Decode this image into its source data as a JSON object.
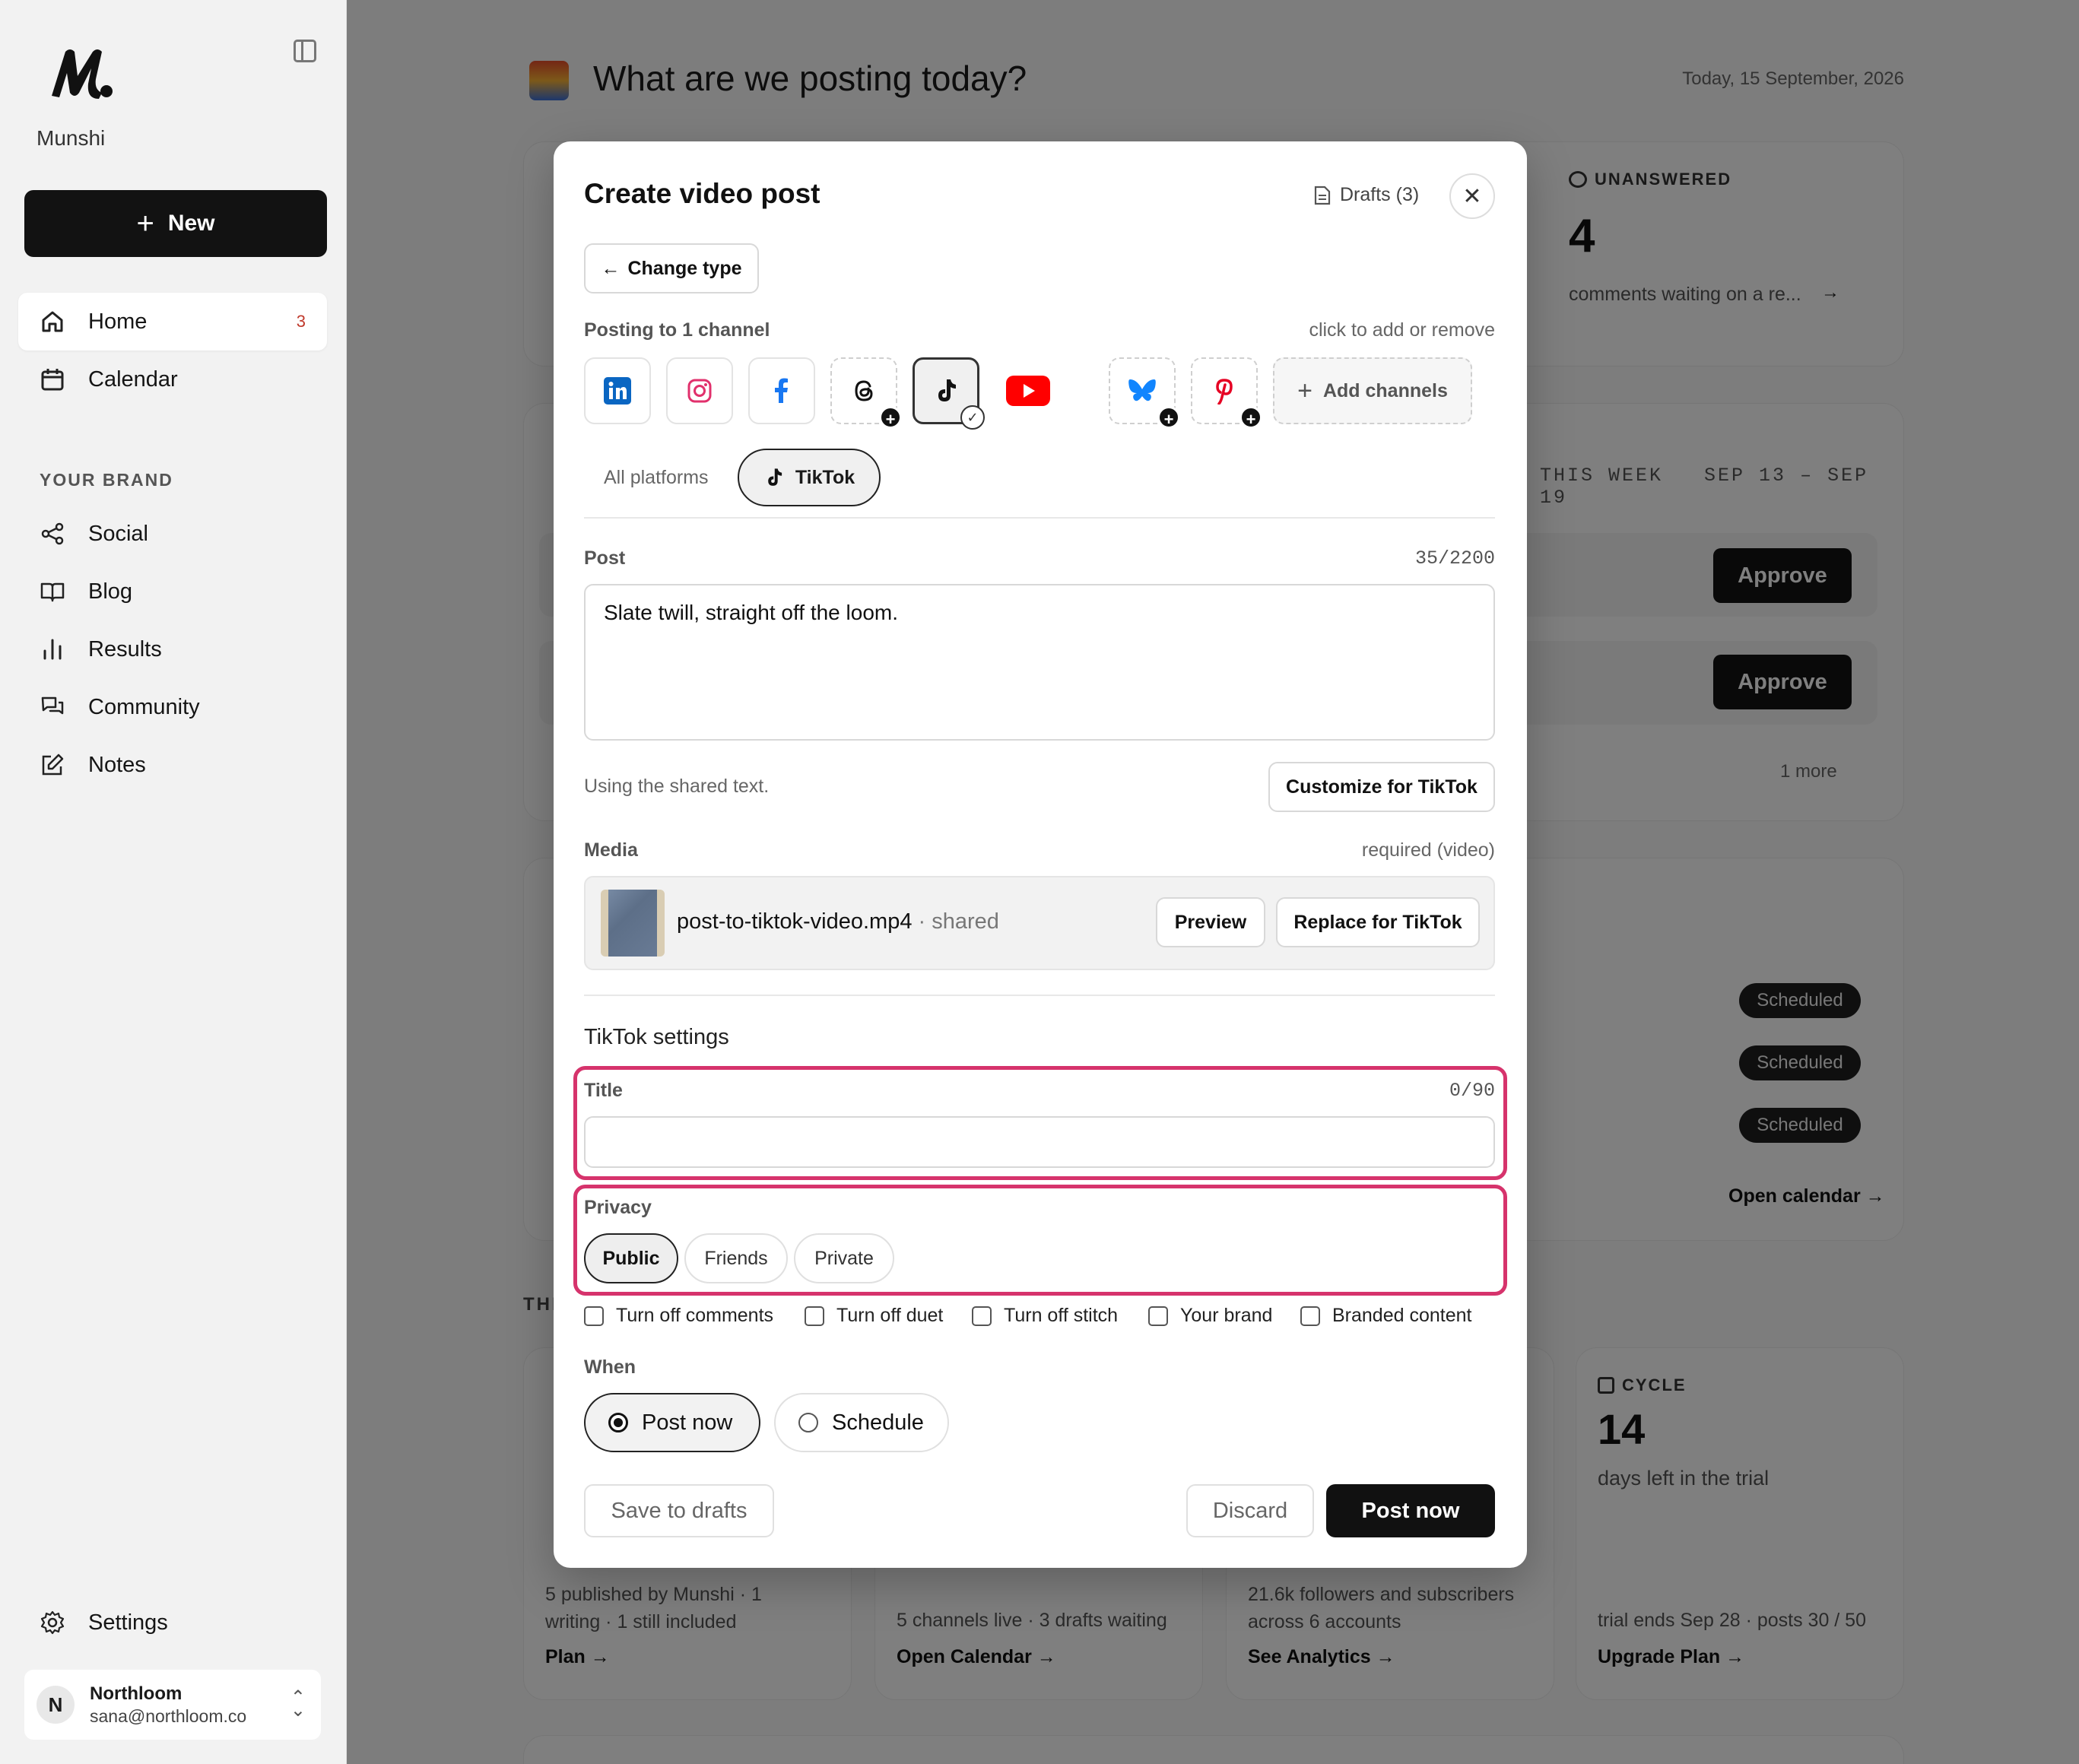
{
  "sidebar": {
    "brand": "Munshi",
    "new_label": "New",
    "nav": [
      {
        "label": "Home",
        "badge": "3"
      },
      {
        "label": "Calendar"
      }
    ],
    "section_label": "YOUR BRAND",
    "brand_nav": [
      {
        "label": "Social"
      },
      {
        "label": "Blog"
      },
      {
        "label": "Results"
      },
      {
        "label": "Community"
      },
      {
        "label": "Notes"
      }
    ],
    "settings_label": "Settings",
    "account": {
      "initial": "N",
      "name": "Northloom",
      "email": "sana@northloom.co"
    }
  },
  "main": {
    "title": "What are we posting today?",
    "date": "Today, 15 September, 2026",
    "unanswered": {
      "label": "UNANSWERED",
      "value": "4",
      "sub": "comments waiting on a re..."
    },
    "week": {
      "label": "THIS WEEK",
      "range": "SEP 13 – SEP 19",
      "approve_label": "Approve",
      "more": "1 more"
    },
    "scheduled_label": "Scheduled",
    "open_calendar": "Open calendar →",
    "section_stub": "THI",
    "cycle": {
      "label": "CYCLE",
      "value": "14",
      "sub": "days left in the trial",
      "foot": "trial ends Sep 28 · posts 30 / 50",
      "link": "Upgrade Plan →"
    },
    "card1": {
      "foot": "5 published by Munshi · 1 writing · 1 still included",
      "link": "Plan →"
    },
    "card2": {
      "foot": "5 channels live · 3 drafts waiting",
      "link": "Open Calendar →"
    },
    "card3": {
      "foot": "21.6k followers and subscribers across 6 accounts",
      "link": "See Analytics →"
    }
  },
  "modal": {
    "title": "Create video post",
    "drafts": "Drafts (3)",
    "change_type": "Change type",
    "posting_to": "Posting to 1 channel",
    "click_hint": "click to add or remove",
    "add_channels": "Add channels",
    "tab_all": "All platforms",
    "tab_active": "TikTok",
    "post_label": "Post",
    "post_count": "35/2200",
    "post_text": "Slate twill, straight off the loom.",
    "shared_note": "Using the shared text.",
    "customize": "Customize for TikTok",
    "media_label": "Media",
    "media_req": "required (video)",
    "file_name": "post-to-tiktok-video.mp4",
    "file_shared": " · shared",
    "preview": "Preview",
    "replace": "Replace for TikTok",
    "settings_title": "TikTok settings",
    "title_label": "Title",
    "title_count": "0/90",
    "privacy_label": "Privacy",
    "privacy_options": [
      "Public",
      "Friends",
      "Private"
    ],
    "checkboxes": [
      "Turn off comments",
      "Turn off duet",
      "Turn off stitch",
      "Your brand",
      "Branded content"
    ],
    "when_label": "When",
    "when_options": [
      "Post now",
      "Schedule"
    ],
    "save_drafts": "Save to drafts",
    "discard": "Discard",
    "post_now": "Post now"
  },
  "colors": {
    "highlight": "#d6336c",
    "linkedin": "#0a66c2",
    "youtube": "#ff0000",
    "facebook": "#1877f2",
    "bluesky": "#1185fe",
    "pinterest": "#e60023",
    "instagram": "#e1306c"
  }
}
